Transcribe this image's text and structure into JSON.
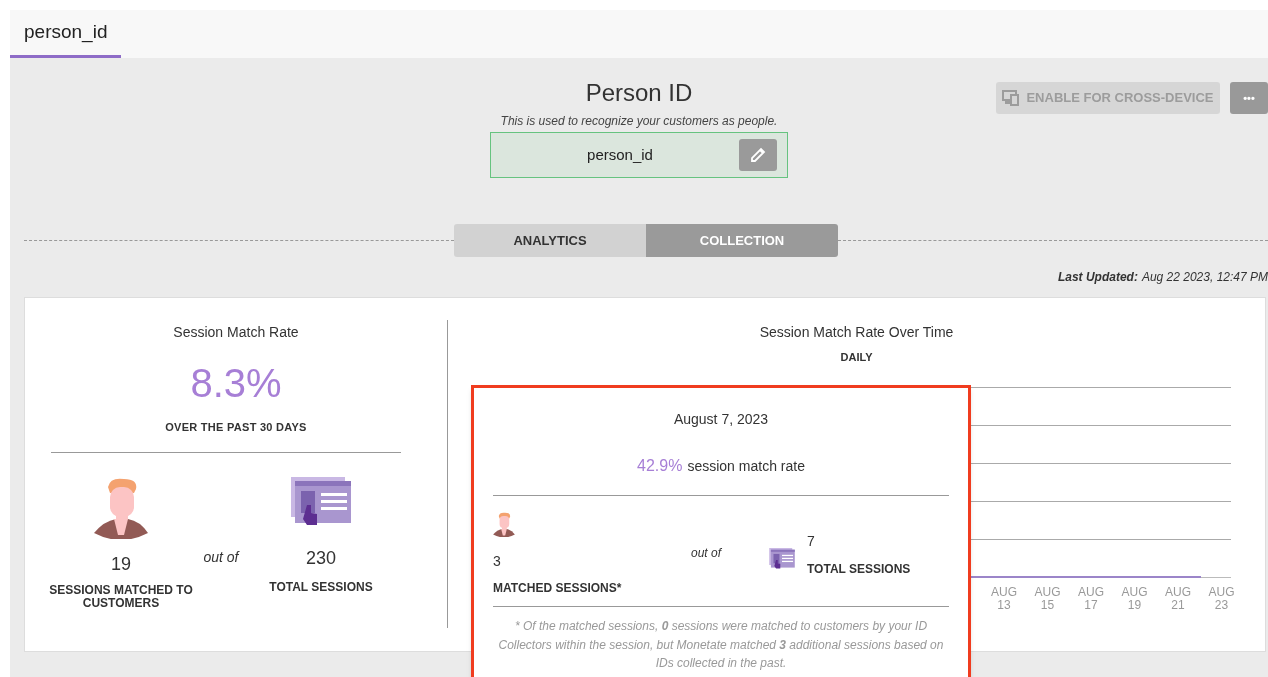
{
  "page_tab": {
    "label": "person_id",
    "selected": true
  },
  "header": {
    "title": "Person ID",
    "subtitle": "This is used to recognize your customers as people.",
    "id_value": "person_id"
  },
  "actions": {
    "cross_device": {
      "label": "ENABLE FOR CROSS-DEVICE",
      "disabled": true
    },
    "more": "•••"
  },
  "view_tabs": [
    {
      "label": "ANALYTICS",
      "selected": false
    },
    {
      "label": "COLLECTION",
      "selected": true
    }
  ],
  "last_updated": {
    "label": "Last Updated:",
    "value": "Aug 22 2023, 12:47 PM"
  },
  "summary": {
    "title": "Session Match Rate",
    "rate": "8.3%",
    "period": "OVER THE PAST 30 DAYS",
    "matched": "19",
    "matched_label": "SESSIONS MATCHED TO CUSTOMERS",
    "out_of": "out of",
    "total": "230",
    "total_label": "TOTAL SESSIONS"
  },
  "chart": {
    "title": "Session Match Rate Over Time",
    "subtitle": "DAILY",
    "x_labels": [
      [
        "AUG",
        "13"
      ],
      [
        "AUG",
        "15"
      ],
      [
        "AUG",
        "17"
      ],
      [
        "AUG",
        "19"
      ],
      [
        "AUG",
        "21"
      ],
      [
        "AUG",
        "23"
      ]
    ]
  },
  "tooltip": {
    "date": "August 7, 2023",
    "rate": "42.9%",
    "rate_label": "session match rate",
    "matched": "3",
    "matched_label": "MATCHED SESSIONS*",
    "out_of": "out of",
    "total": "7",
    "total_label": "TOTAL SESSIONS",
    "footnote": "* Of the matched sessions,  **0**  sessions were matched to customers by your ID Collectors within the session, but Monetate matched **3** additional sessions based on IDs collected in the past."
  }
}
